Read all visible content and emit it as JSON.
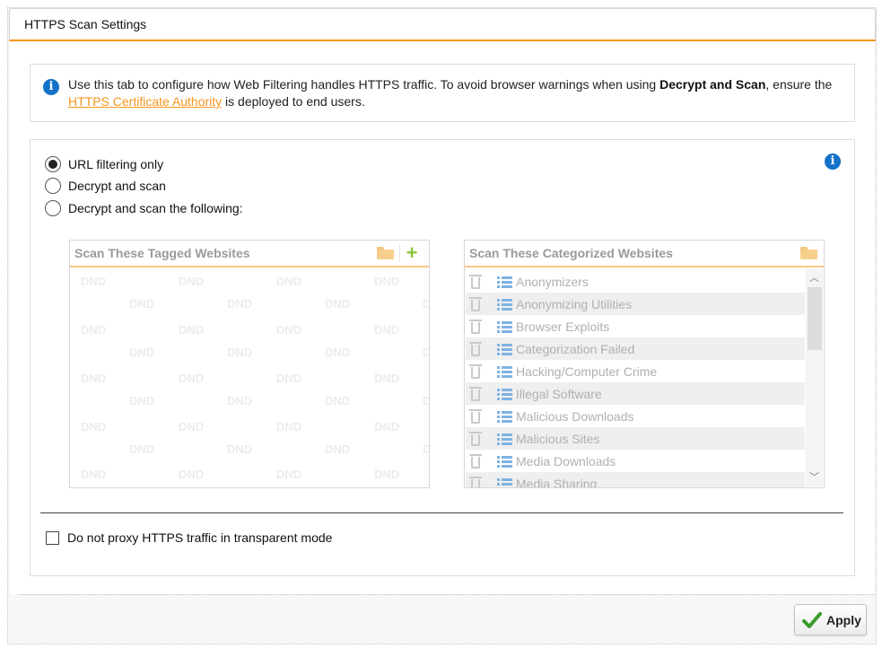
{
  "window": {
    "title": "HTTPS Scan Settings"
  },
  "info": {
    "text_before": "Use this tab to configure how Web Filtering handles HTTPS traffic. To avoid browser warnings when using ",
    "bold": "Decrypt and Scan",
    "text_mid": ", ensure the ",
    "link": "HTTPS Certificate Authority",
    "text_after": " is deployed to end users."
  },
  "scan_mode": {
    "options": [
      {
        "label": "URL filtering only",
        "checked": true
      },
      {
        "label": "Decrypt and scan",
        "checked": false
      },
      {
        "label": "Decrypt and scan the following:",
        "checked": false
      }
    ]
  },
  "tagged_panel": {
    "title": "Scan These Tagged Websites",
    "placeholder_text": "DND"
  },
  "categorized_panel": {
    "title": "Scan These Categorized Websites",
    "items": [
      "Anonymizers",
      "Anonymizing Utilities",
      "Browser Exploits",
      "Categorization Failed",
      "Hacking/Computer Crime",
      "Illegal Software",
      "Malicious Downloads",
      "Malicious Sites",
      "Media Downloads",
      "Media Sharing"
    ]
  },
  "transparent_mode": {
    "label": "Do not proxy HTTPS traffic in transparent mode",
    "checked": false
  },
  "footer": {
    "apply_label": "Apply"
  },
  "icons": {
    "info": "info-icon",
    "folder": "folder-icon",
    "plus": "plus-icon",
    "trash": "trash-icon",
    "list": "list-icon",
    "check": "check-icon"
  },
  "colors": {
    "accent": "#f7941d",
    "link": "#f7941d",
    "info_blue": "#1572c8",
    "add_green": "#8cc63f",
    "check_green": "#3a9a2a"
  }
}
